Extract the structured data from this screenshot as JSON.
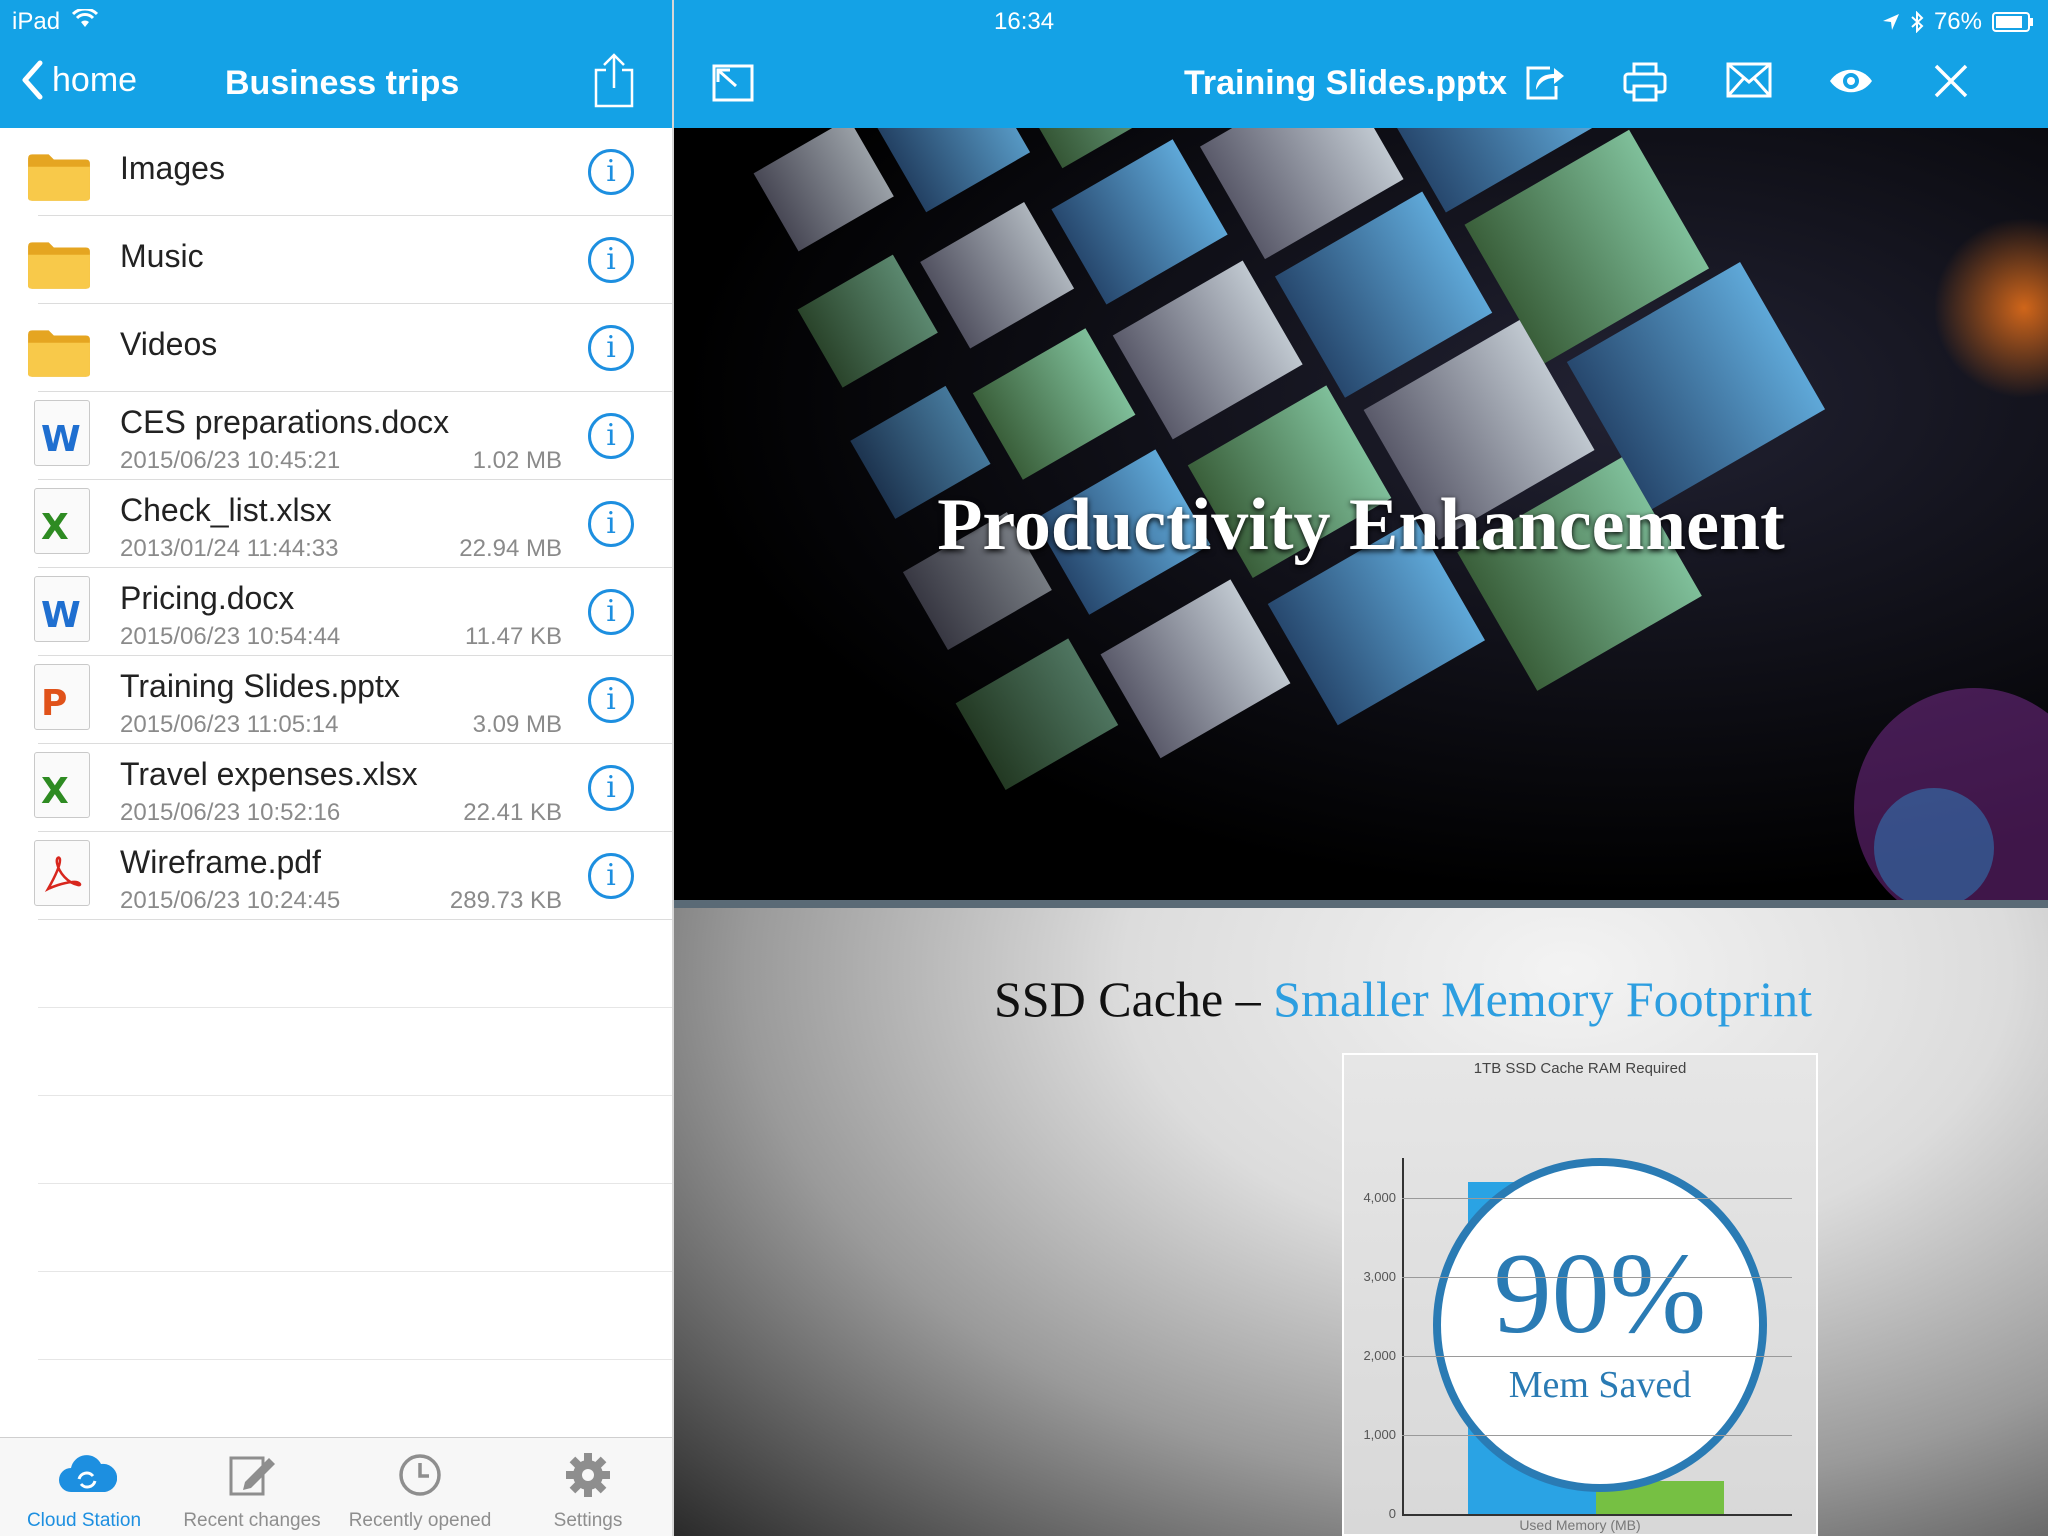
{
  "status": {
    "carrier": "iPad",
    "time": "16:34",
    "battery": "76%"
  },
  "left_nav": {
    "back_label": "home",
    "title": "Business trips"
  },
  "right_nav": {
    "title": "Training Slides.pptx"
  },
  "files": [
    {
      "type": "folder",
      "name": "Images"
    },
    {
      "type": "folder",
      "name": "Music"
    },
    {
      "type": "folder",
      "name": "Videos"
    },
    {
      "type": "word",
      "badge": "W",
      "color": "#1f6fd0",
      "name": "CES preparations.docx",
      "date": "2015/06/23 10:45:21",
      "size": "1.02 MB"
    },
    {
      "type": "excel",
      "badge": "X",
      "color": "#2e8b22",
      "name": "Check_list.xlsx",
      "date": "2013/01/24 11:44:33",
      "size": "22.94 MB"
    },
    {
      "type": "word",
      "badge": "W",
      "color": "#1f6fd0",
      "name": "Pricing.docx",
      "date": "2015/06/23 10:54:44",
      "size": "11.47 KB"
    },
    {
      "type": "powerpoint",
      "badge": "P",
      "color": "#e0521a",
      "name": "Training Slides.pptx",
      "date": "2015/06/23 11:05:14",
      "size": "3.09 MB"
    },
    {
      "type": "excel",
      "badge": "X",
      "color": "#2e8b22",
      "name": "Travel expenses.xlsx",
      "date": "2015/06/23 10:52:16",
      "size": "22.41 KB"
    },
    {
      "type": "pdf",
      "badge": "",
      "color": "#d8261d",
      "name": "Wireframe.pdf",
      "date": "2015/06/23 10:24:45",
      "size": "289.73 KB"
    }
  ],
  "tabs": [
    {
      "label": "Cloud Station",
      "icon": "cloud-sync-icon",
      "active": true
    },
    {
      "label": "Recent changes",
      "icon": "edit-icon",
      "active": false
    },
    {
      "label": "Recently opened",
      "icon": "clock-icon",
      "active": false
    },
    {
      "label": "Settings",
      "icon": "gear-icon",
      "active": false
    }
  ],
  "slide1": {
    "title": "Productivity Enhancement"
  },
  "slide2": {
    "title_part1": "SSD Cache – ",
    "title_part2": "Smaller Memory Footprint",
    "chart_title": "1TB SSD Cache RAM Required",
    "percent": "90%",
    "percent_label": "Mem Saved",
    "x_label": "Used Memory (MB)"
  },
  "chart_data": {
    "type": "bar",
    "title": "1TB SSD Cache RAM Required",
    "xlabel": "Used Memory (MB)",
    "ylabel": "",
    "ylim": [
      0,
      4500
    ],
    "yticks": [
      "0",
      "1,000",
      "2,000",
      "3,000",
      "4,000"
    ],
    "categories": [
      "",
      ""
    ],
    "series": [
      {
        "name": "",
        "values": [
          4200,
          420
        ],
        "colors": [
          "#2aa3e4",
          "#76c043"
        ]
      }
    ]
  },
  "colors": {
    "accent": "#14a2e6",
    "info": "#1d8fe0",
    "chart_circle": "#2a7bb4"
  }
}
